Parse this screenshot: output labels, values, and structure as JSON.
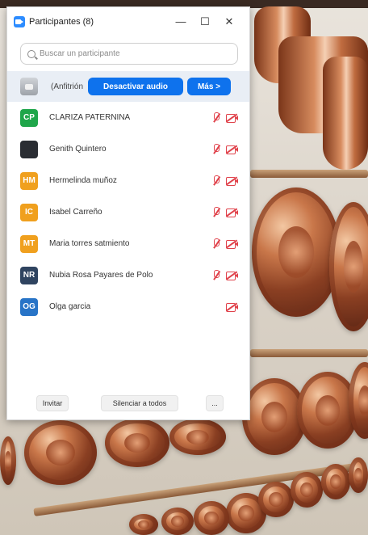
{
  "window": {
    "title": "Participantes (8)",
    "minimize_glyph": "—",
    "maximize_glyph": "☐",
    "close_glyph": "✕"
  },
  "search": {
    "placeholder": "Buscar un participante"
  },
  "host": {
    "name": "(Anfitrión",
    "audio_button": "Desactivar audio",
    "more_button": "Más >"
  },
  "participants": [
    {
      "initials": "CP",
      "name": "CLARIZA PATERNINA",
      "color": "#1fa64a",
      "mic_muted": true,
      "cam_off": true
    },
    {
      "initials": "",
      "name": "Genith Quintero",
      "color": "#2a2d33",
      "mic_muted": true,
      "cam_off": true
    },
    {
      "initials": "HM",
      "name": "Hermelinda muñoz",
      "color": "#f0a01e",
      "mic_muted": true,
      "cam_off": true
    },
    {
      "initials": "IC",
      "name": "Isabel Carreño",
      "color": "#f0a01e",
      "mic_muted": true,
      "cam_off": true
    },
    {
      "initials": "MT",
      "name": "Maria torres satmiento",
      "color": "#f0a01e",
      "mic_muted": true,
      "cam_off": true
    },
    {
      "initials": "NR",
      "name": "Nubia Rosa Payares de Polo",
      "color": "#2f4460",
      "mic_muted": true,
      "cam_off": true
    },
    {
      "initials": "OG",
      "name": "Olga garcia",
      "color": "#2874c7",
      "mic_muted": false,
      "cam_off": true
    }
  ],
  "footer": {
    "invite": "Invitar",
    "mute_all": "Silenciar a todos",
    "more": "..."
  },
  "colors": {
    "accent": "#0e72ed",
    "muted_red": "#e0424b"
  },
  "icons": {
    "app": "zoom-camera-icon",
    "search": "search-icon",
    "mic": "mic-muted-icon",
    "camera": "video-off-icon"
  }
}
